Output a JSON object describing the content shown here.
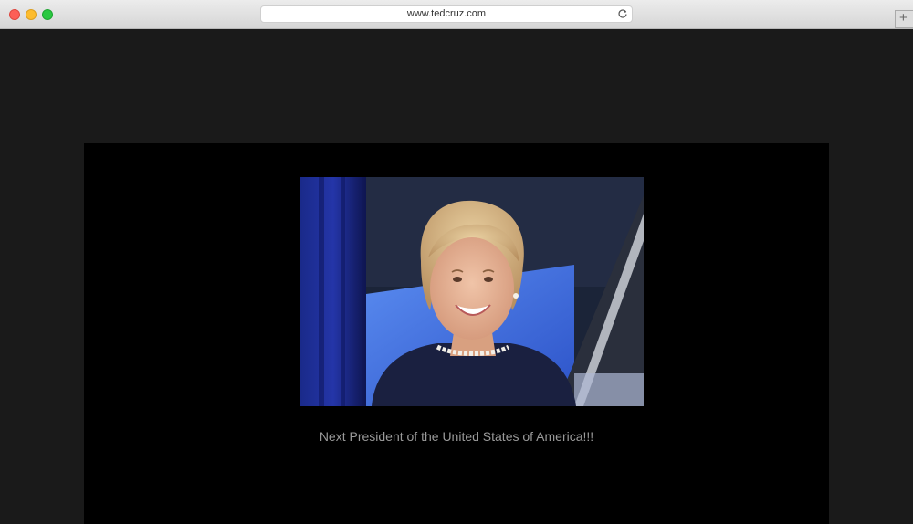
{
  "browser": {
    "url": "www.tedcruz.com",
    "new_tab_symbol": "+",
    "icons": {
      "close": "close-window-icon",
      "minimize": "minimize-window-icon",
      "zoom": "zoom-window-icon",
      "reload": "reload-icon",
      "new_tab": "plus-icon"
    }
  },
  "page": {
    "caption": "Next President of the United States of America!!!"
  },
  "colors": {
    "page_background": "#1a1a1a",
    "content_background": "#000000",
    "caption_text": "#9a9a9a"
  }
}
